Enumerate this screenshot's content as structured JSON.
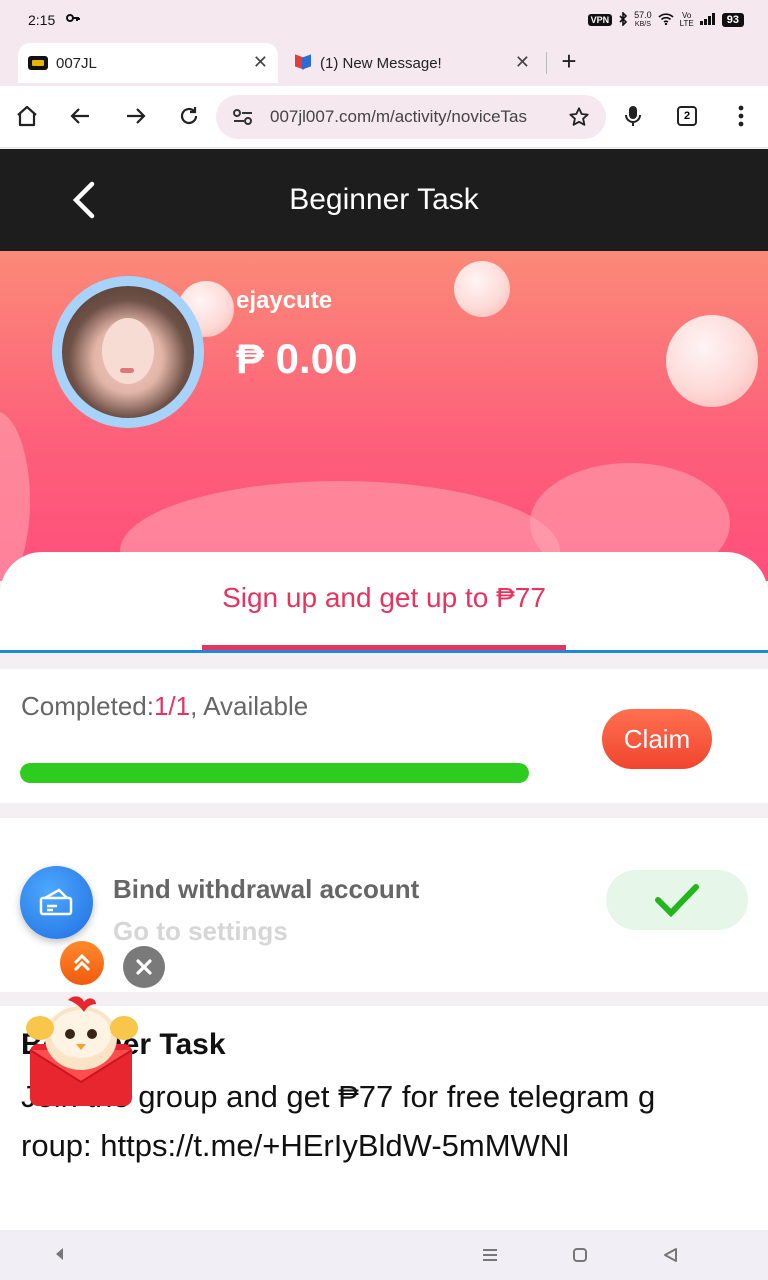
{
  "status_bar": {
    "time": "2:15",
    "vpn": "VPN",
    "net_speed_value": "57.0",
    "net_speed_unit": "KB/S",
    "battery": "93"
  },
  "tabs": [
    {
      "title": "007JL"
    },
    {
      "title": "(1) New Message!"
    }
  ],
  "toolbar": {
    "url": "007jl007.com/m/activity/noviceTas",
    "tab_count": "2"
  },
  "header": {
    "title": "Beginner Task"
  },
  "profile": {
    "username": "ejaycute",
    "balance": "₱ 0.00"
  },
  "task_tab": {
    "label": "Sign up and get up to ₱77"
  },
  "progress": {
    "label_prefix": "Completed:",
    "count": "1/1",
    "label_suffix": ", Available",
    "fraction": 1.0,
    "claim_label": "Claim"
  },
  "bind": {
    "title": "Bind withdrawal account",
    "subtitle": "Go to settings"
  },
  "description": {
    "title": "Beginner Task",
    "text": "Join the group and get ₱77 for free telegram group: https://t.me/+HErIyBldW-5mMWNl"
  },
  "colors": {
    "accent": "#e7335f",
    "progress": "#2ecc1f",
    "claim": "#f0452f",
    "header_bg": "#1d1d1d"
  }
}
